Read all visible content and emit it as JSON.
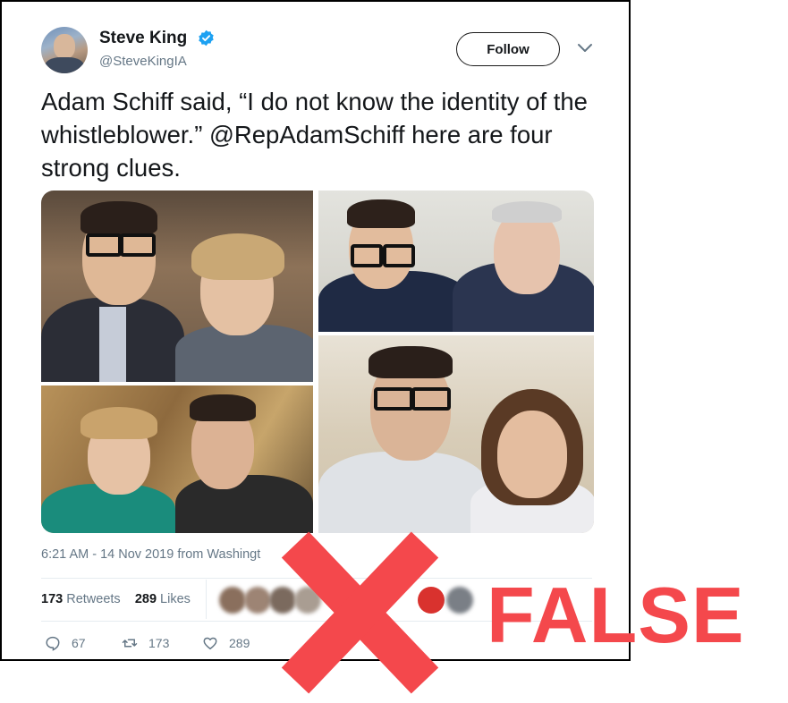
{
  "author": {
    "display_name": "Steve King",
    "handle": "@SteveKingIA",
    "verified": true
  },
  "header": {
    "follow_label": "Follow"
  },
  "tweet": {
    "text": "Adam Schiff said, “I do not know the identity of the whistleblower.” @RepAdamSchiff here are four strong clues.",
    "media": [
      {
        "description": "Young man in dark glasses beside a woman with short blonde hair"
      },
      {
        "description": "Young man in dark glasses beside an older man in glasses"
      },
      {
        "description": "Woman in glasses and teal top beside a young man"
      },
      {
        "description": "Young man in dark glasses beside a woman with shoulder-length hair"
      }
    ],
    "timestamp_visible": "6:21 AM - 14 Nov 2019 from Washingt",
    "stats": {
      "retweets_count": "173",
      "retweets_label": "Retweets",
      "likes_count": "289",
      "likes_label": "Likes"
    },
    "actions": {
      "reply_count": "67",
      "retweet_count": "173",
      "like_count": "289"
    }
  },
  "overlay": {
    "verdict": "FALSE",
    "verdict_color": "#f4484c"
  },
  "icons": {
    "verified": "verified-badge-icon",
    "more": "chevron-down-icon",
    "reply": "reply-icon",
    "retweet": "retweet-icon",
    "like": "heart-icon"
  },
  "colors": {
    "text": "#14171a",
    "secondary": "#657786",
    "verified_blue": "#1da1f2",
    "divider": "#e6ecf0"
  }
}
